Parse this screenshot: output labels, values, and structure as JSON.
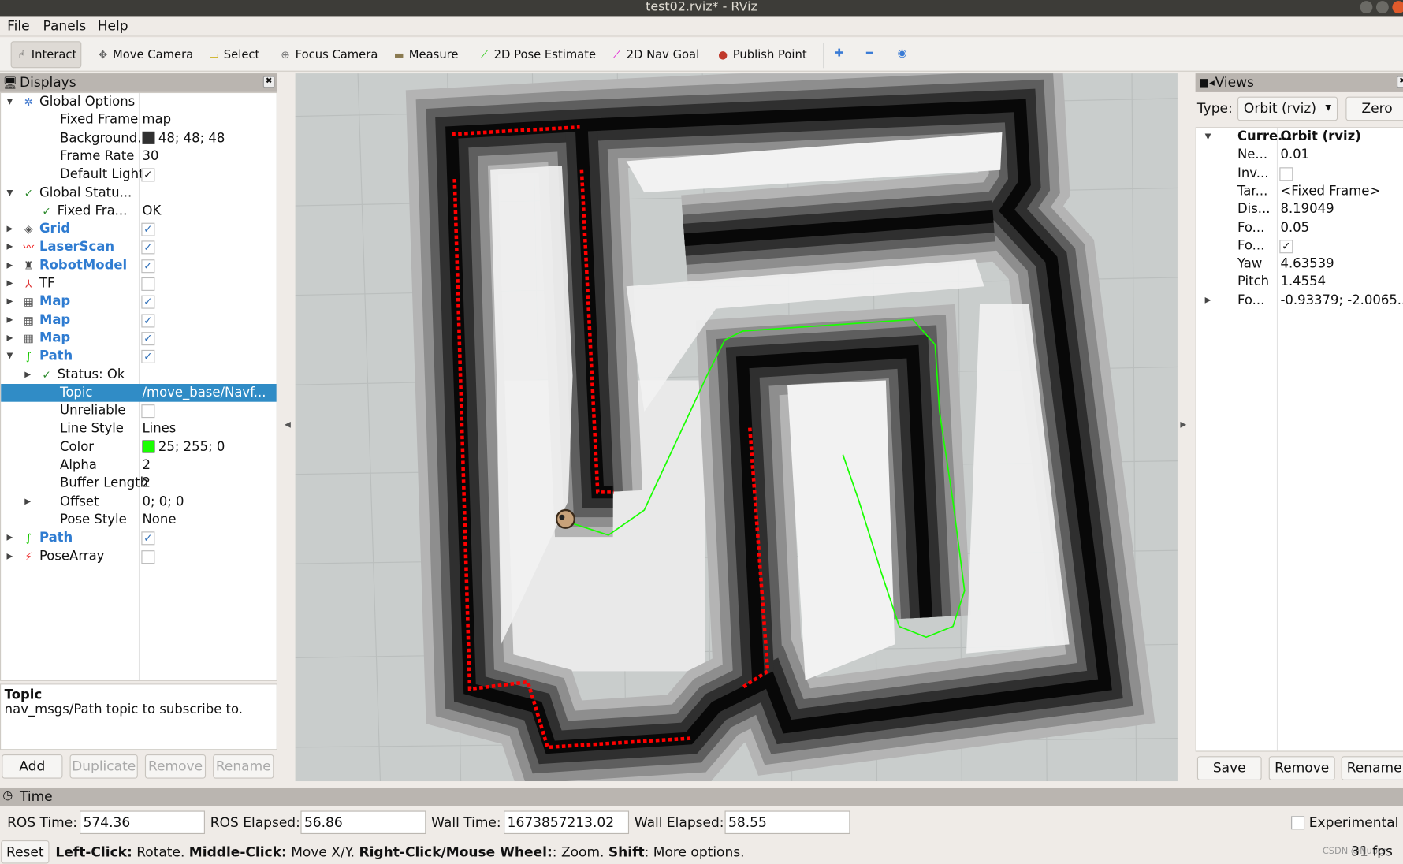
{
  "window": {
    "title": "test02.rviz* - RViz"
  },
  "menu": [
    {
      "label": "File"
    },
    {
      "label": "Panels"
    },
    {
      "label": "Help"
    }
  ],
  "toolbar": [
    {
      "label": "Interact",
      "icon": "hand-icon",
      "active": true
    },
    {
      "label": "Move Camera",
      "icon": "move-camera-icon"
    },
    {
      "label": "Select",
      "icon": "select-icon"
    },
    {
      "label": "Focus Camera",
      "icon": "focus-camera-icon"
    },
    {
      "label": "Measure",
      "icon": "ruler-icon"
    },
    {
      "label": "2D Pose Estimate",
      "icon": "green-arrow-icon"
    },
    {
      "label": "2D Nav Goal",
      "icon": "magenta-arrow-icon"
    },
    {
      "label": "Publish Point",
      "icon": "map-pin-icon"
    }
  ],
  "displays": {
    "title": "Displays",
    "rows": [
      {
        "label": "Global Options",
        "indent": 0,
        "arrow": "down",
        "icon": "gear-icon"
      },
      {
        "label": "Fixed Frame",
        "value": "map",
        "indent": 1
      },
      {
        "label": "Background...",
        "value": "48; 48; 48",
        "swatch": "#303030",
        "indent": 1
      },
      {
        "label": "Frame Rate",
        "value": "30",
        "indent": 1
      },
      {
        "label": "Default Light",
        "check": true,
        "indent": 1
      },
      {
        "label": "Global Statu...",
        "indent": 0,
        "arrow": "down",
        "icon": "check-icon"
      },
      {
        "label": "Fixed Fra...",
        "value": "OK",
        "indent": 1,
        "icon": "check-icon"
      },
      {
        "label": "Grid",
        "indent": 0,
        "arrow": "right",
        "icon": "grid-icon",
        "blue": true,
        "check": true
      },
      {
        "label": "LaserScan",
        "indent": 0,
        "arrow": "right",
        "icon": "laserscan-icon",
        "blue": true,
        "check": true
      },
      {
        "label": "RobotModel",
        "indent": 0,
        "arrow": "right",
        "icon": "robot-icon",
        "blue": true,
        "check": true
      },
      {
        "label": "TF",
        "indent": 0,
        "arrow": "right",
        "icon": "tf-axes-icon",
        "check": false
      },
      {
        "label": "Map",
        "indent": 0,
        "arrow": "right",
        "icon": "map-icon",
        "blue": true,
        "check": true
      },
      {
        "label": "Map",
        "indent": 0,
        "arrow": "right",
        "icon": "map-icon",
        "blue": true,
        "check": true
      },
      {
        "label": "Map",
        "indent": 0,
        "arrow": "right",
        "icon": "map-icon",
        "blue": true,
        "check": true
      },
      {
        "label": "Path",
        "indent": 0,
        "arrow": "down",
        "icon": "path-icon",
        "blue": true,
        "check": true
      },
      {
        "label": "Status: Ok",
        "indent": 1,
        "arrow": "right",
        "icon": "check-icon"
      },
      {
        "label": "Topic",
        "value": "/move_base/Navf...",
        "indent": 1,
        "selected": true
      },
      {
        "label": "Unreliable",
        "check": false,
        "indent": 1
      },
      {
        "label": "Line Style",
        "value": "Lines",
        "indent": 1
      },
      {
        "label": "Color",
        "value": "25; 255; 0",
        "swatch": "#19ff00",
        "indent": 1
      },
      {
        "label": "Alpha",
        "value": "2",
        "indent": 1
      },
      {
        "label": "Buffer Length",
        "value": "2",
        "indent": 1
      },
      {
        "label": "Offset",
        "value": "0; 0; 0",
        "indent": 1,
        "arrow": "right"
      },
      {
        "label": "Pose Style",
        "value": "None",
        "indent": 1
      },
      {
        "label": "Path",
        "indent": 0,
        "arrow": "right",
        "icon": "path-icon",
        "blue": true,
        "check": true
      },
      {
        "label": "PoseArray",
        "indent": 0,
        "arrow": "right",
        "icon": "posearray-icon",
        "check": false
      }
    ],
    "description": {
      "title": "Topic",
      "text": "nav_msgs/Path topic to subscribe to."
    },
    "buttons": [
      {
        "label": "Add",
        "enabled": true
      },
      {
        "label": "Duplicate",
        "enabled": false
      },
      {
        "label": "Remove",
        "enabled": false
      },
      {
        "label": "Rename",
        "enabled": false
      }
    ]
  },
  "views": {
    "title": "Views",
    "type_label": "Type:",
    "type_value": "Orbit (rviz)",
    "zero_label": "Zero",
    "rows": [
      {
        "label": "Curre...",
        "value": "Orbit (rviz)",
        "bold": true,
        "arrow": "down"
      },
      {
        "label": "Ne...",
        "value": "0.01"
      },
      {
        "label": "Inv...",
        "check": false
      },
      {
        "label": "Tar...",
        "value": "<Fixed Frame>"
      },
      {
        "label": "Dis...",
        "value": "8.19049"
      },
      {
        "label": "Fo...",
        "value": "0.05"
      },
      {
        "label": "Fo...",
        "check": true
      },
      {
        "label": "Yaw",
        "value": "4.63539"
      },
      {
        "label": "Pitch",
        "value": "1.4554"
      },
      {
        "label": "Fo...",
        "value": "-0.93379; -2.0065...",
        "arrow": "right"
      }
    ],
    "buttons": [
      {
        "label": "Save"
      },
      {
        "label": "Remove"
      },
      {
        "label": "Rename"
      }
    ]
  },
  "time": {
    "title": "Time",
    "ros_time_label": "ROS Time:",
    "ros_time": "574.36",
    "ros_elapsed_label": "ROS Elapsed:",
    "ros_elapsed": "56.86",
    "wall_time_label": "Wall Time:",
    "wall_time": "1673857213.02",
    "wall_elapsed_label": "Wall Elapsed:",
    "wall_elapsed": "58.55",
    "experimental_label": "Experimental"
  },
  "status": {
    "reset_label": "Reset",
    "hint": [
      [
        "Left-Click:",
        true
      ],
      [
        " Rotate. ",
        false
      ],
      [
        "Middle-Click:",
        true
      ],
      [
        " Move X/Y. ",
        false
      ],
      [
        "Right-Click/Mouse Wheel:",
        true
      ],
      [
        ": Zoom. ",
        false
      ],
      [
        "Shift",
        true
      ],
      [
        ": More options.",
        false
      ]
    ],
    "fps": "31 fps",
    "watermark": "CSDN @Nuber"
  },
  "colors": {
    "path": "#19ff00",
    "laser": "#ff0000",
    "selection": "#308cc6",
    "background": "#303030"
  }
}
